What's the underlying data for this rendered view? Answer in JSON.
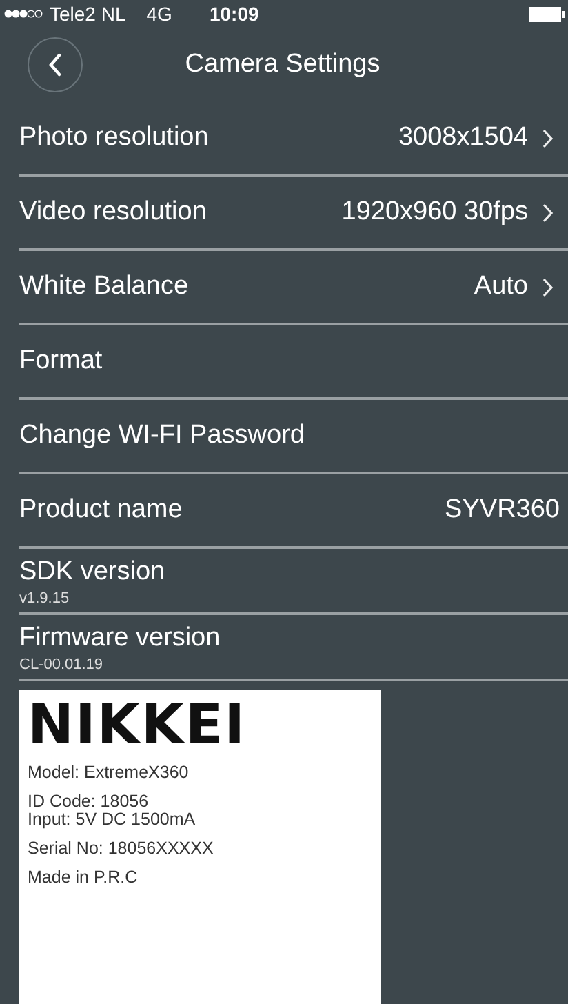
{
  "status_bar": {
    "carrier": "Tele2 NL",
    "network": "4G",
    "time": "10:09"
  },
  "nav": {
    "title": "Camera Settings"
  },
  "rows": [
    {
      "kind": "link",
      "label": "Photo resolution",
      "value": "3008x1504"
    },
    {
      "kind": "link",
      "label": "Video resolution",
      "value": "1920x960 30fps"
    },
    {
      "kind": "link",
      "label": "White Balance",
      "value": "Auto"
    },
    {
      "kind": "action",
      "label": "Format"
    },
    {
      "kind": "action",
      "label": "Change WI-FI Password"
    },
    {
      "kind": "info",
      "label": "Product name",
      "value": "SYVR360"
    },
    {
      "kind": "detail",
      "label": "SDK version",
      "value": "v1.9.15"
    },
    {
      "kind": "detail",
      "label": "Firmware version",
      "value": "CL-00.01.19"
    }
  ],
  "product_label": {
    "brand": "NIKKEI",
    "groups": [
      [
        "Model: ExtremeX360"
      ],
      [
        "ID Code: 18056",
        "Input: 5V DC 1500mA"
      ],
      [
        "Serial No: 18056XXXXX"
      ],
      [
        "Made in P.R.C"
      ]
    ]
  }
}
